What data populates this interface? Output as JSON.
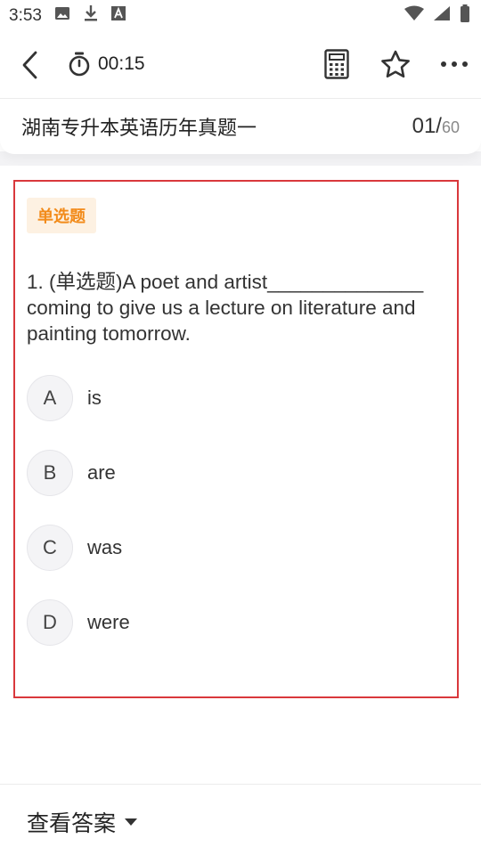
{
  "status_bar": {
    "time": "3:53",
    "icons": [
      "image-icon",
      "download-icon",
      "font-icon",
      "wifi-icon",
      "signal-icon",
      "battery-icon"
    ]
  },
  "toolbar": {
    "timer": "00:15",
    "icons": [
      "back-arrow-icon",
      "stopwatch-icon",
      "calculator-icon",
      "star-icon",
      "more-icon"
    ]
  },
  "header": {
    "title": "湖南专升本英语历年真题一",
    "current": "01/",
    "total": "60"
  },
  "question": {
    "type_tag": "单选题",
    "text": "1. (单选题)A poet and artist______________ coming to give us a lecture on literature and painting tomorrow.",
    "options": [
      {
        "letter": "A",
        "text": "is"
      },
      {
        "letter": "B",
        "text": "are"
      },
      {
        "letter": "C",
        "text": "was"
      },
      {
        "letter": "D",
        "text": "were"
      }
    ]
  },
  "footer": {
    "answer_label": "查看答案"
  },
  "colors": {
    "highlight_border": "#d9383c",
    "tag_text": "#f28b1a",
    "tag_bg": "#fdf1e2"
  }
}
